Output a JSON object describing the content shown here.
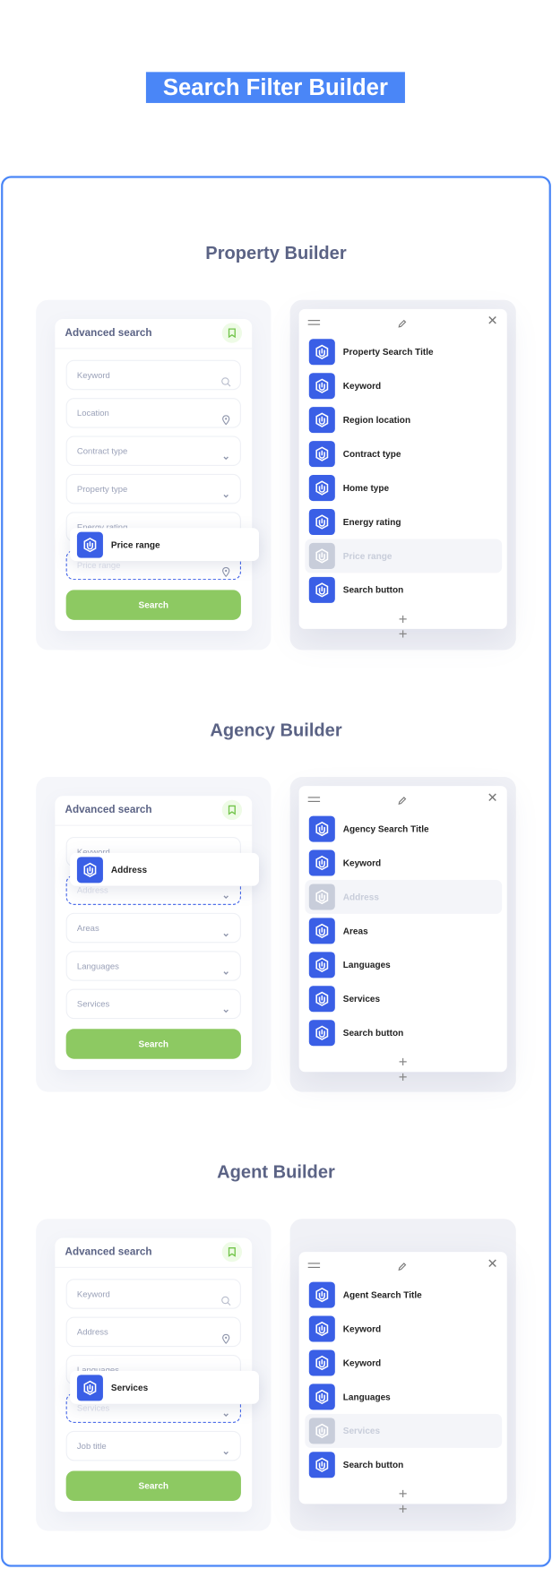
{
  "title": "Search Filter Builder",
  "colors": {
    "accent": "#4a86f7",
    "icon_blue": "#3a5fe6",
    "search_green": "#8dc962",
    "heading": "#5b6385"
  },
  "sections": [
    {
      "heading": "Property Builder",
      "form_title": "Advanced search",
      "search_label": "Search",
      "fields": [
        {
          "label": "Keyword",
          "icon": "search"
        },
        {
          "label": "Location",
          "icon": "pin"
        },
        {
          "label": "Contract type",
          "icon": "chevron"
        },
        {
          "label": "Property type",
          "icon": "chevron"
        },
        {
          "label": "Energy rating",
          "icon": "chevron"
        },
        {
          "label": "Price range",
          "icon": "pin",
          "dragging": true
        }
      ],
      "drag_label": "Price range",
      "items": [
        {
          "label": "Property Search Title"
        },
        {
          "label": "Keyword"
        },
        {
          "label": "Region location"
        },
        {
          "label": "Contract type"
        },
        {
          "label": "Home type"
        },
        {
          "label": "Energy rating"
        },
        {
          "label": "Price range",
          "dim": true
        },
        {
          "label": "Search button"
        }
      ]
    },
    {
      "heading": "Agency Builder",
      "form_title": "Advanced search",
      "search_label": "Search",
      "fields": [
        {
          "label": "Keyword",
          "icon": "search"
        },
        {
          "label": "Address",
          "icon": "chevron",
          "dragging": true
        },
        {
          "label": "Areas",
          "icon": "chevron"
        },
        {
          "label": "Languages",
          "icon": "chevron"
        },
        {
          "label": "Services",
          "icon": "chevron"
        }
      ],
      "drag_label": "Address",
      "items": [
        {
          "label": "Agency Search Title"
        },
        {
          "label": "Keyword"
        },
        {
          "label": "Address",
          "dim": true
        },
        {
          "label": "Areas"
        },
        {
          "label": "Languages"
        },
        {
          "label": "Services"
        },
        {
          "label": "Search button"
        }
      ]
    },
    {
      "heading": "Agent Builder",
      "form_title": "Advanced search",
      "search_label": "Search",
      "fields": [
        {
          "label": "Keyword",
          "icon": "search"
        },
        {
          "label": "Address",
          "icon": "pin"
        },
        {
          "label": "Languages",
          "icon": "chevron"
        },
        {
          "label": "Services",
          "icon": "chevron",
          "dragging": true
        },
        {
          "label": "Job title",
          "icon": "chevron"
        }
      ],
      "drag_label": "Services",
      "items": [
        {
          "label": "Agent Search Title"
        },
        {
          "label": "Keyword"
        },
        {
          "label": "Keyword"
        },
        {
          "label": "Languages"
        },
        {
          "label": "Services",
          "dim": true
        },
        {
          "label": "Search button"
        }
      ]
    }
  ]
}
